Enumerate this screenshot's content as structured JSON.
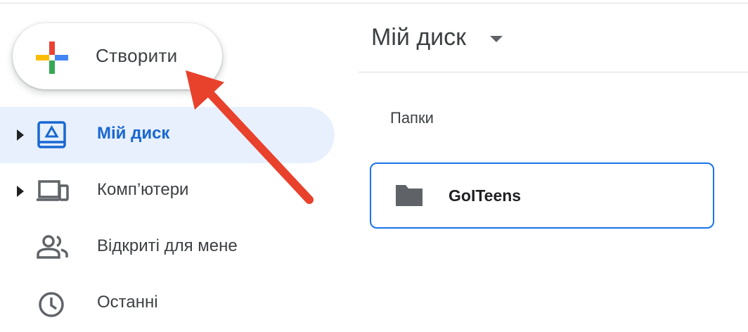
{
  "new_button": {
    "label": "Створити"
  },
  "sidebar": {
    "items": [
      {
        "label": "Мій диск",
        "active": true,
        "has_caret": true,
        "icon": "drive-icon"
      },
      {
        "label": "Комп’ютери",
        "active": false,
        "has_caret": true,
        "icon": "computers-icon"
      },
      {
        "label": "Відкриті для мене",
        "active": false,
        "has_caret": false,
        "icon": "shared-people-icon"
      },
      {
        "label": "Останні",
        "active": false,
        "has_caret": false,
        "icon": "clock-icon"
      }
    ]
  },
  "main": {
    "title": "Мій диск",
    "section_label": "Папки",
    "folders": [
      {
        "name": "GoITeens"
      }
    ]
  },
  "colors": {
    "accent": "#1a73e8",
    "active_bg": "#e8f0fe",
    "active_text": "#1967d2",
    "icon_gray": "#5f6368",
    "arrow_red": "#e8412c"
  }
}
